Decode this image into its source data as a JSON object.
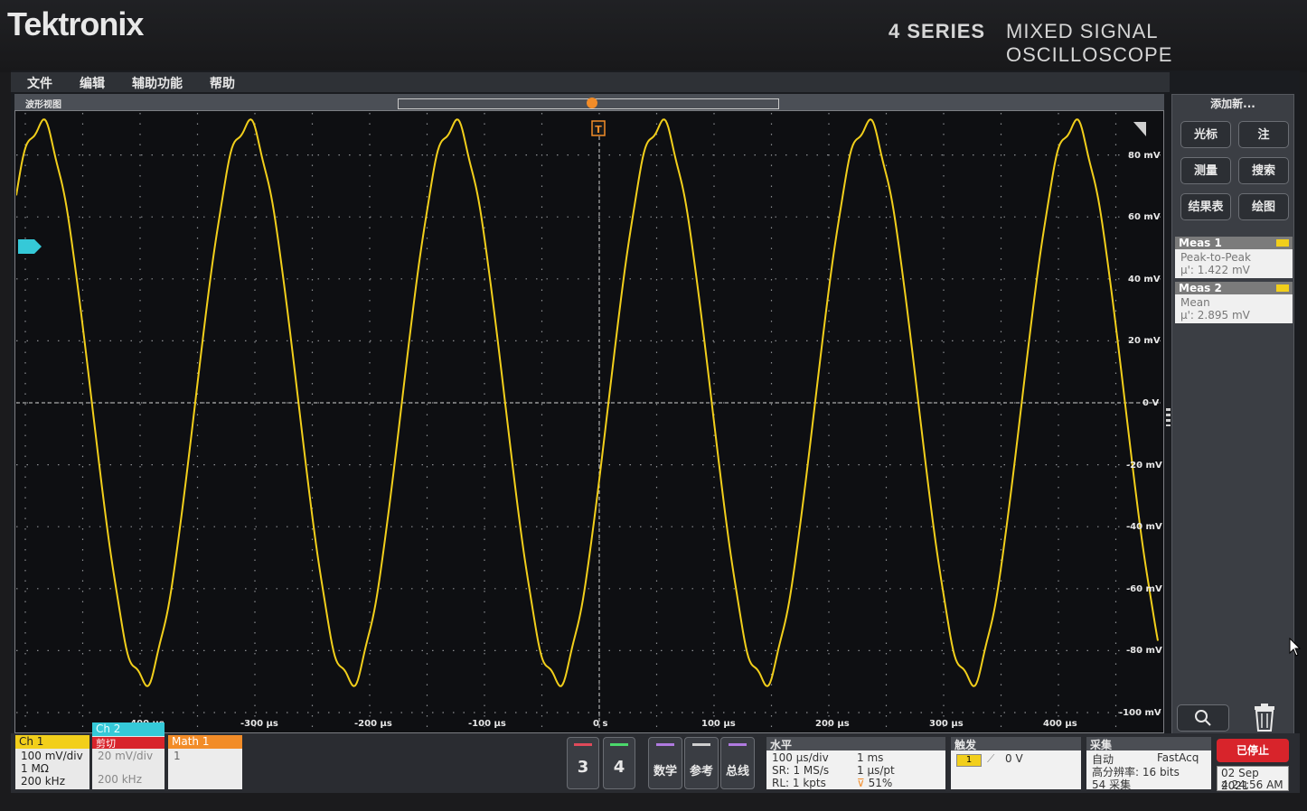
{
  "brand": "Tektronix",
  "series": "4 SERIES",
  "product": "MIXED SIGNAL OSCILLOSCOPE",
  "menu": [
    "文件",
    "编辑",
    "辅助功能",
    "帮助"
  ],
  "waveform_view_title": "波形视图",
  "trigger_marker": "T",
  "y_axis_labels": [
    "80 mV",
    "60 mV",
    "40 mV",
    "20 mV",
    "0 V",
    "-20 mV",
    "-40 mV",
    "-60 mV",
    "-80 mV",
    "-100 mV"
  ],
  "x_axis_labels": [
    "-400 µs",
    "-300 µs",
    "-200 µs",
    "-100 µs",
    "0 s",
    "100 µs",
    "200 µs",
    "300 µs",
    "400 µs"
  ],
  "waveform": {
    "color": "#f2cf1b",
    "amplitude_mV": 90,
    "period_us": 180,
    "phase_peak_us": -487
  },
  "add_new": {
    "title": "添加新...",
    "buttons": [
      "光标",
      "注",
      "测量",
      "搜索",
      "结果表",
      "绘图"
    ]
  },
  "measurements": [
    {
      "name": "Meas 1",
      "type": "Peak-to-Peak",
      "value": "μ': 1.422 mV"
    },
    {
      "name": "Meas 2",
      "type": "Mean",
      "value": "μ': 2.895 mV"
    }
  ],
  "ch1": {
    "label": "Ch 1",
    "scale": "100 mV/div",
    "impedance": "1 MΩ",
    "bandwidth": "200 kHz",
    "color": "#f2cf1b"
  },
  "ch2": {
    "label": "Ch 2",
    "status": "剪切",
    "scale": "20 mV/div",
    "bandwidth": "200 kHz",
    "color": "#35c9d8"
  },
  "math1": {
    "label": "Math 1",
    "value": "1",
    "color": "#f28c28"
  },
  "channel_buttons": [
    "3",
    "4"
  ],
  "group_buttons": [
    "数学",
    "参考",
    "总线"
  ],
  "horizontal": {
    "title": "水平",
    "scale": "100 µs/div",
    "duration": "1 ms",
    "sr": "SR: 1 MS/s",
    "pt": "1 µs/pt",
    "rl": "RL: 1 kpts",
    "pos": "51%"
  },
  "trigger": {
    "title": "触发",
    "source": "1",
    "level": "0 V"
  },
  "acquisition": {
    "title": "采集",
    "mode": "自动",
    "fastacq": "FastAcq",
    "resolution": "高分辨率: 16 bits",
    "count": "54 采集"
  },
  "run_state": "已停止",
  "date": "02 Sep 2021",
  "time": "4:24:56 AM"
}
